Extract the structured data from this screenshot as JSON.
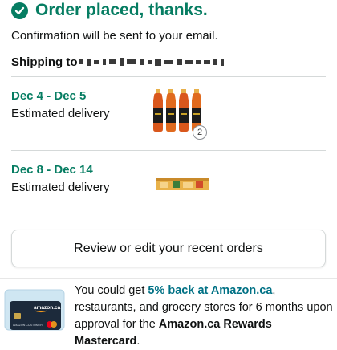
{
  "header": {
    "title": "Order placed, thanks."
  },
  "confirmation": {
    "text": "Confirmation will be sent to your email."
  },
  "shipping": {
    "label": "Shipping to"
  },
  "deliveries": [
    {
      "date_range": "Dec 4 - Dec 5",
      "subtitle": "Estimated delivery",
      "item_count": "2",
      "item_icon": "juice-bottles-image"
    },
    {
      "date_range": "Dec 8 - Dec 14",
      "subtitle": "Estimated delivery",
      "item_icon": "snack-box-image"
    }
  ],
  "review_button": {
    "label": "Review or edit your recent orders"
  },
  "promo": {
    "text_1": "You could get ",
    "link": "5% back at Amazon.ca",
    "text_2": ", restaurants, and grocery stores for 6 months upon approval for the ",
    "card_name": "Amazon.ca Rewards Mastercard",
    "text_3": ".",
    "card_brand": "amazon.ca",
    "card_holder": "AMAZON CUSTOMER"
  },
  "colors": {
    "accent_green": "#067d62",
    "link_teal": "#007185",
    "divider": "#d5d9d9"
  }
}
